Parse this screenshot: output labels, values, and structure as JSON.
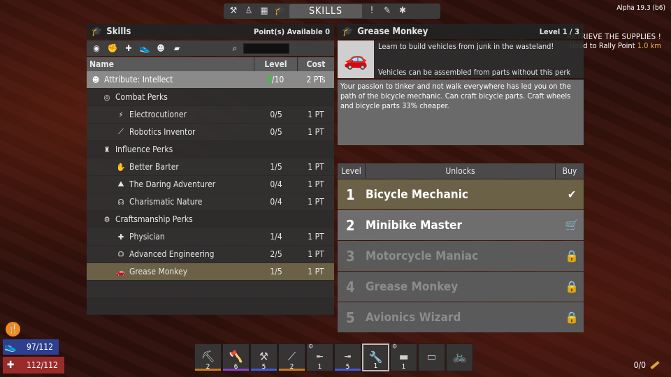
{
  "top_menu": {
    "active_tab": "SKILLS"
  },
  "version": "Alpha 19.3 (b6)",
  "quest": {
    "title": "RETRIEVE THE SUPPLIES",
    "objective": "Head to Rally Point",
    "distance": "1.0 km"
  },
  "skills": {
    "title": "Skills",
    "points_available": "Point(s) Available 0",
    "columns": {
      "name": "Name",
      "level": "Level",
      "cost": "Cost"
    },
    "attribute": {
      "name": "Attribute: Intellect",
      "level": "/10",
      "cost": "2 PTs"
    },
    "categories": [
      {
        "name": "Combat Perks",
        "perks": [
          {
            "name": "Electrocutioner",
            "level": "0/5",
            "cost": "1 PT",
            "icon": "lightning-icon"
          },
          {
            "name": "Robotics Inventor",
            "level": "0/5",
            "cost": "1 PT",
            "icon": "turret-icon"
          }
        ]
      },
      {
        "name": "Influence Perks",
        "perks": [
          {
            "name": "Better Barter",
            "level": "1/5",
            "cost": "1 PT",
            "icon": "handshake-icon"
          },
          {
            "name": "The Daring Adventurer",
            "level": "0/4",
            "cost": "1 PT",
            "icon": "adventurer-icon"
          },
          {
            "name": "Charismatic Nature",
            "level": "0/4",
            "cost": "1 PT",
            "icon": "speech-icon"
          }
        ]
      },
      {
        "name": "Craftsmanship Perks",
        "perks": [
          {
            "name": "Physician",
            "level": "1/4",
            "cost": "1 PT",
            "icon": "medkit-icon"
          },
          {
            "name": "Advanced Engineering",
            "level": "2/5",
            "cost": "1 PT",
            "icon": "workbench-icon"
          },
          {
            "name": "Grease Monkey",
            "level": "1/5",
            "cost": "1 PT",
            "icon": "car-icon"
          }
        ]
      }
    ]
  },
  "detail": {
    "title": "Grease Monkey",
    "level": "Level 1 / 3",
    "summary": "Learn to build vehicles from junk in the wasteland!",
    "note": "Vehicles can be assembled from parts without this perk",
    "description": "Your passion to tinker and not walk everywhere has led you on the path of the bicycle mechanic. Can craft bicycle parts. Craft wheels and bicycle parts 33% cheaper.",
    "columns": {
      "level": "Level",
      "unlocks": "Unlocks",
      "buy": "Buy"
    },
    "unlocks": [
      {
        "level": "1",
        "name": "Bicycle Mechanic",
        "status": "owned"
      },
      {
        "level": "2",
        "name": "Minibike Master",
        "status": "buy"
      },
      {
        "level": "3",
        "name": "Motorcycle Maniac",
        "status": "locked"
      },
      {
        "level": "4",
        "name": "Grease Monkey",
        "status": "locked"
      },
      {
        "level": "5",
        "name": "Avionics Wizard",
        "status": "locked"
      }
    ]
  },
  "hud": {
    "stamina": "97/112",
    "health": "112/112"
  },
  "toolbelt": [
    {
      "icon": "pickaxe-icon",
      "count": "2",
      "quality_color": "#c8781e"
    },
    {
      "icon": "stone-axe-icon",
      "count": "6",
      "quality_color": "#8a3fc8"
    },
    {
      "icon": "sledgehammer-icon",
      "count": "5",
      "quality_color": "#3f5ad8"
    },
    {
      "icon": "shovel-icon",
      "count": "2",
      "quality_color": "#c8781e"
    },
    {
      "icon": "rifle-icon",
      "count": "1",
      "quality_color": "",
      "gear": true
    },
    {
      "icon": "shotgun-icon",
      "count": "5",
      "quality_color": "#3f5ad8"
    },
    {
      "icon": "wrench-icon",
      "count": "1",
      "quality_color": "",
      "active": true
    },
    {
      "icon": "gun-icon",
      "count": "1",
      "quality_color": "",
      "gear": true
    },
    {
      "icon": "flashlight-icon",
      "count": "",
      "quality_color": ""
    },
    {
      "icon": "bicycle-icon",
      "count": "",
      "quality_color": ""
    }
  ],
  "ammo": "0/0"
}
